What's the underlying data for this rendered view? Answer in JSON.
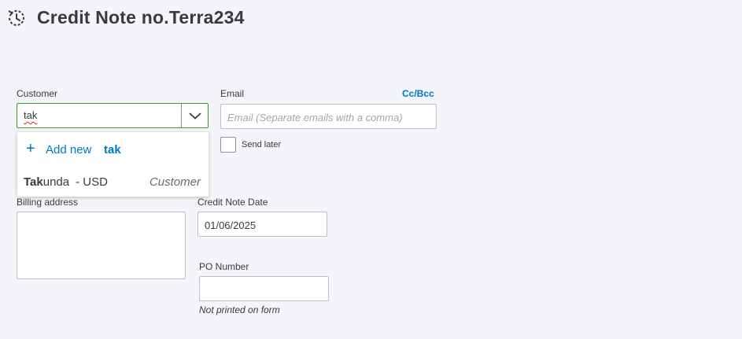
{
  "header": {
    "icon": "history-icon",
    "title": "Credit Note no.Terra234"
  },
  "customer": {
    "label": "Customer",
    "input_value": "tak",
    "toggle_icon": "chevron-down-icon",
    "dropdown": {
      "add_icon": "plus-icon",
      "add_label": "Add new",
      "add_query": "tak",
      "items": [
        {
          "match": "Tak",
          "rest": "unda",
          "currency": "- USD",
          "type": "Customer"
        }
      ]
    }
  },
  "email": {
    "label": "Email",
    "cc_bcc_label": "Cc/Bcc",
    "placeholder": "Email (Separate emails with a comma)",
    "send_later_label": "Send later"
  },
  "billing": {
    "label": "Billing address"
  },
  "credit_note_date": {
    "label": "Credit Note Date",
    "value": "01/06/2025"
  },
  "po_number": {
    "label": "PO Number",
    "hint": "Not printed on form"
  },
  "colors": {
    "accent_green": "#2ca01c",
    "link_blue": "#0077c5",
    "text": "#393a3d",
    "background": "#f4f5f8"
  }
}
